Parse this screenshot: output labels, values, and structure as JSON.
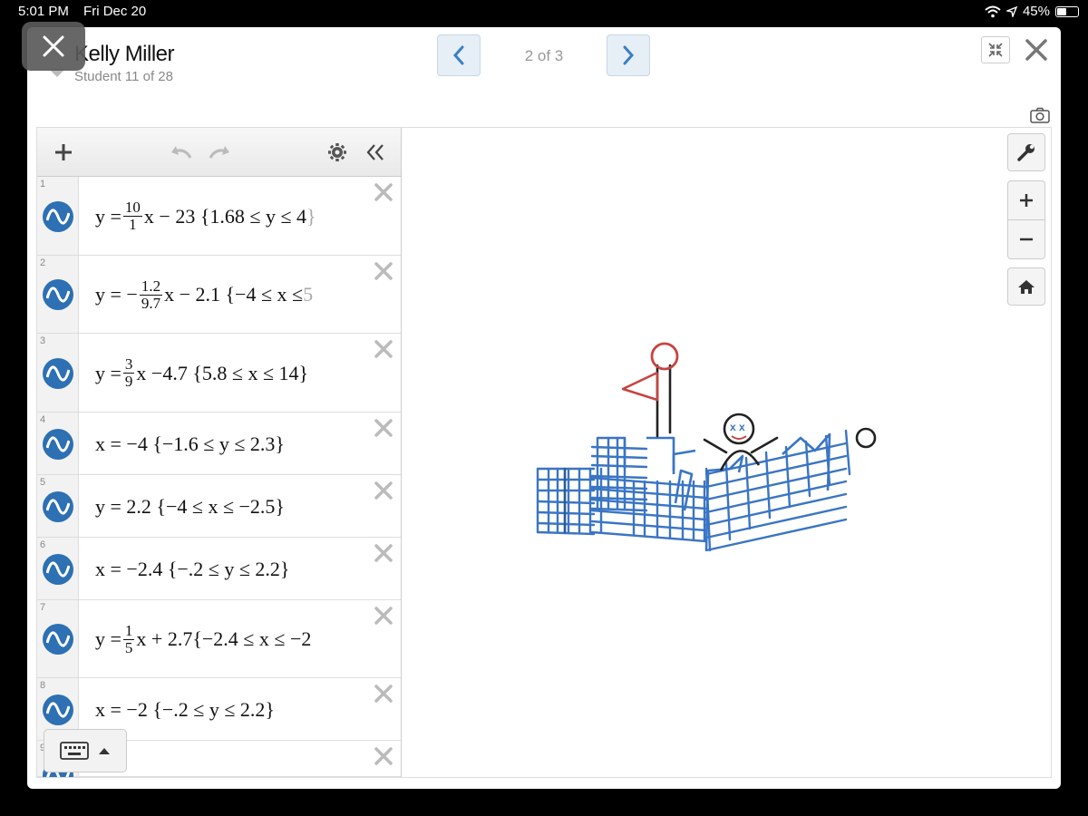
{
  "status_bar": {
    "time": "5:01 PM",
    "date": "Fri Dec 20",
    "battery": "45%"
  },
  "header": {
    "student_name": "Kelly Miller",
    "student_sub": "Student 11 of 28",
    "page_indicator": "2 of 3"
  },
  "icons": {
    "close_overlay": "close-icon",
    "prev": "chevron-left-icon",
    "next": "chevron-right-icon",
    "collapse": "collapse-icon",
    "close": "close-icon",
    "camera": "camera-icon",
    "add": "plus-icon",
    "undo": "undo-icon",
    "redo": "redo-icon",
    "settings": "gear-icon",
    "hide_panel": "double-chevron-left-icon",
    "wrench": "wrench-icon",
    "zoom_in": "plus-icon",
    "zoom_out": "minus-icon",
    "home": "home-icon",
    "keyboard": "keyboard-icon",
    "expand_up": "caret-up-icon"
  },
  "colors": {
    "accent": "#2d70b3",
    "graph_blue": "#3a75c4",
    "graph_red": "#c74440",
    "graph_black": "#222222"
  },
  "expressions": [
    {
      "num": "1",
      "a": "y =",
      "frac": [
        "10",
        "1"
      ],
      "b": "x − 23 {1.68 ≤ y ≤ 4",
      "tail": "}"
    },
    {
      "num": "2",
      "a": "y = −",
      "frac": [
        "1.2",
        "9.7"
      ],
      "b": "x − 2.1 {−4 ≤ x ≤",
      "tail": "5"
    },
    {
      "num": "3",
      "a": "y =",
      "frac": [
        "3",
        "9"
      ],
      "b": "x −4.7 {5.8 ≤ x ≤ 14}",
      "tail": ""
    },
    {
      "num": "4",
      "a": "x = −4 {−1.6 ≤ y ≤ 2.3}",
      "frac": null,
      "b": "",
      "tail": ""
    },
    {
      "num": "5",
      "a": "y = 2.2 {−4 ≤ x ≤ −2.5}",
      "frac": null,
      "b": "",
      "tail": ""
    },
    {
      "num": "6",
      "a": "x = −2.4 {−.2 ≤ y ≤ 2.2}",
      "frac": null,
      "b": "",
      "tail": ""
    },
    {
      "num": "7",
      "a": "y =",
      "frac": [
        "1",
        "5"
      ],
      "b": "x + 2.7{−2.4 ≤ x ≤ −2",
      "tail": ""
    },
    {
      "num": "8",
      "a": "x = −2 {−.2 ≤ y ≤ 2.2}",
      "frac": null,
      "b": "",
      "tail": ""
    },
    {
      "num": "9",
      "a": "",
      "frac": null,
      "b": "",
      "tail": ""
    }
  ]
}
